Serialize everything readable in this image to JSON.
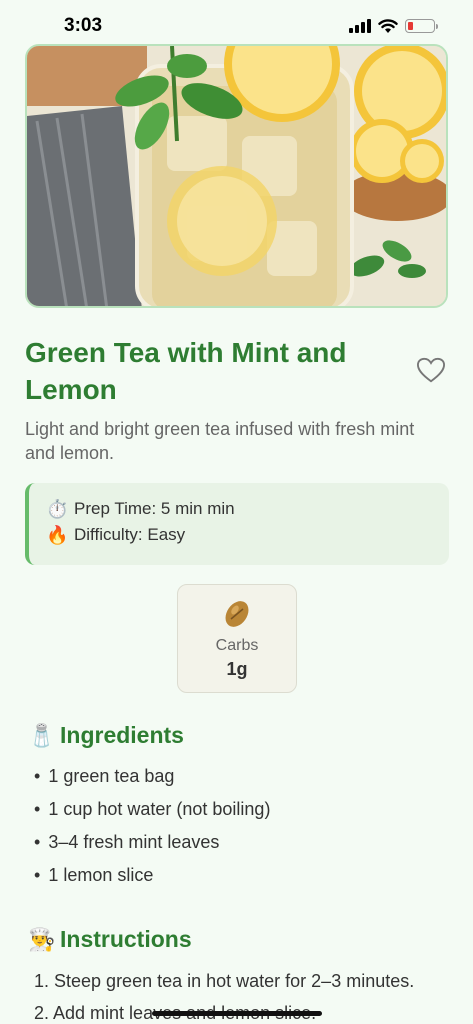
{
  "status_bar": {
    "time": "3:03",
    "battery_color": "#e53935"
  },
  "recipe": {
    "title": "Green Tea with Mint and Lemon",
    "description": "Light and bright green tea infused with fresh mint and lemon.",
    "favorite_icon": "heart-outline-icon",
    "info": {
      "prep_icon": "⏱️",
      "prep_time": "Prep Time: 5 min min",
      "difficulty_icon": "🔥",
      "difficulty": "Difficulty: Easy"
    },
    "nutrition": {
      "label": "Carbs",
      "value": "1g",
      "icon": "bean-icon"
    }
  },
  "ingredients": {
    "icon": "🧂",
    "heading": "Ingredients",
    "items": [
      "1 green tea bag",
      "1 cup hot water (not boiling)",
      "3–4 fresh mint leaves",
      "1 lemon slice"
    ]
  },
  "instructions": {
    "icon": "👨‍🍳",
    "heading": "Instructions",
    "steps": [
      "1. Steep green tea in hot water for 2–3 minutes.",
      "2. Add mint leaves and lemon slice."
    ]
  },
  "colors": {
    "accent": "#2e7d32",
    "info_border": "#66bb6a",
    "background": "#f4fbf4"
  }
}
